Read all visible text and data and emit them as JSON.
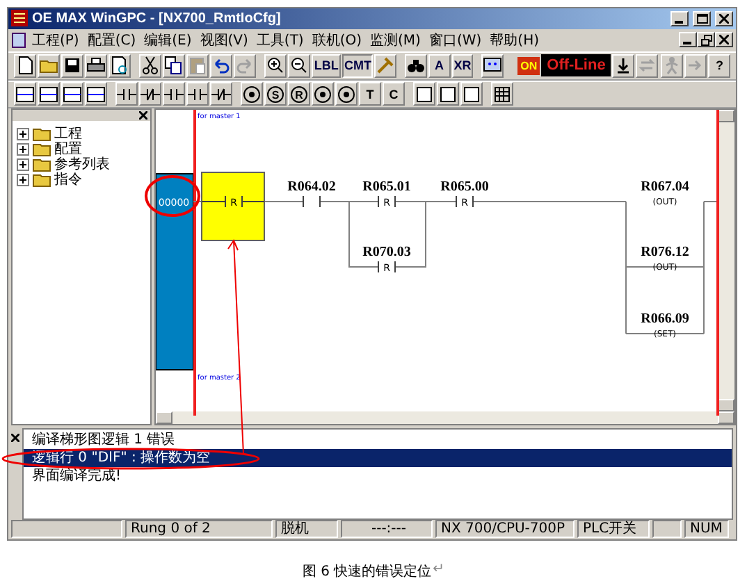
{
  "window": {
    "title": "OE MAX WinGPC - [NX700_RmtIoCfg]"
  },
  "menu": [
    "工程(P)",
    "配置(C)",
    "编辑(E)",
    "视图(V)",
    "工具(T)",
    "联机(O)",
    "监测(M)",
    "窗口(W)",
    "帮助(H)"
  ],
  "toolbar": [
    {
      "kind": "button"
    },
    {
      "kind": "button"
    },
    {
      "kind": "button"
    },
    {
      "kind": "button"
    },
    {
      "kind": "button"
    },
    {
      "kind": "separator"
    },
    {
      "kind": "button"
    },
    {
      "kind": "button"
    },
    {
      "kind": "button",
      "disabled": true
    },
    {
      "kind": "button"
    },
    {
      "kind": "button",
      "disabled": true
    },
    {
      "kind": "separator"
    },
    {
      "kind": "button"
    },
    {
      "kind": "button"
    },
    {
      "kind": "text_button",
      "text": "LBL",
      "pressed": false
    },
    {
      "kind": "text_button",
      "text": "CMT",
      "pressed": true
    },
    {
      "kind": "button"
    },
    {
      "kind": "separator"
    },
    {
      "kind": "button"
    },
    {
      "kind": "text_button",
      "text": "A",
      "pressed": false
    },
    {
      "kind": "text_button",
      "text": "XR",
      "pressed": false
    },
    {
      "kind": "separator"
    },
    {
      "kind": "button"
    },
    {
      "kind": "separator"
    },
    {
      "kind": "status",
      "text": "ON"
    },
    {
      "kind": "mode",
      "text": "Off-Line"
    },
    {
      "kind": "button"
    },
    {
      "kind": "button",
      "disabled": true
    },
    {
      "kind": "spacer"
    },
    {
      "kind": "button",
      "disabled": true
    },
    {
      "kind": "button",
      "disabled": true
    },
    {
      "kind": "text_button",
      "text": "?",
      "pressed": false
    }
  ],
  "ladder_toolbar": [
    {
      "kind": "button"
    },
    {
      "kind": "button"
    },
    {
      "kind": "button"
    },
    {
      "kind": "button"
    },
    {
      "kind": "separator"
    },
    {
      "kind": "button"
    },
    {
      "kind": "button"
    },
    {
      "kind": "button"
    },
    {
      "kind": "button"
    },
    {
      "kind": "button"
    },
    {
      "kind": "separator"
    },
    {
      "kind": "coil"
    },
    {
      "kind": "coil",
      "text": "S"
    },
    {
      "kind": "coil",
      "text": "R"
    },
    {
      "kind": "coil"
    },
    {
      "kind": "coil"
    },
    {
      "kind": "text_button",
      "text": "T"
    },
    {
      "kind": "text_button",
      "text": "C"
    },
    {
      "kind": "separator"
    },
    {
      "kind": "button"
    },
    {
      "kind": "button"
    },
    {
      "kind": "button"
    },
    {
      "kind": "separator"
    },
    {
      "kind": "button"
    }
  ],
  "project_tree": [
    {
      "label": "工程",
      "expanded": false
    },
    {
      "label": "配置",
      "expanded": false
    },
    {
      "label": "参考列表",
      "expanded": false
    },
    {
      "label": "指令",
      "expanded": false
    }
  ],
  "ladder": {
    "rung_number": "00000",
    "top_comment": "for master 1",
    "bottom_comment": "for master 2",
    "error_contact": "R",
    "contacts": [
      {
        "address": "R064.02",
        "kind": "no"
      },
      {
        "address": "R065.01",
        "kind": "r",
        "text": "R"
      },
      {
        "address": "R070.03",
        "kind": "r",
        "text": "R"
      },
      {
        "address": "R065.00",
        "kind": "r",
        "text": "R"
      }
    ],
    "coils": [
      {
        "address": "R067.04",
        "text": "(OUT)"
      },
      {
        "address": "R076.12",
        "text": "(OUT)"
      },
      {
        "address": "R066.09",
        "text": "(SET)"
      }
    ]
  },
  "output": [
    {
      "text": "编译梯形图逻辑  1 错误",
      "selected": false
    },
    {
      "text": "逻辑行 0 \"DIF\" : 操作数为空",
      "selected": true
    },
    {
      "text": "界面编译完成!",
      "selected": false
    }
  ],
  "status_bar": [
    "Rung 0 of 2",
    "脱机",
    "---:---",
    "NX 700/CPU-700P",
    "PLC开关",
    "NUM"
  ],
  "caption": {
    "text": "图 6 快速的错误定位",
    "mark": "↵"
  }
}
